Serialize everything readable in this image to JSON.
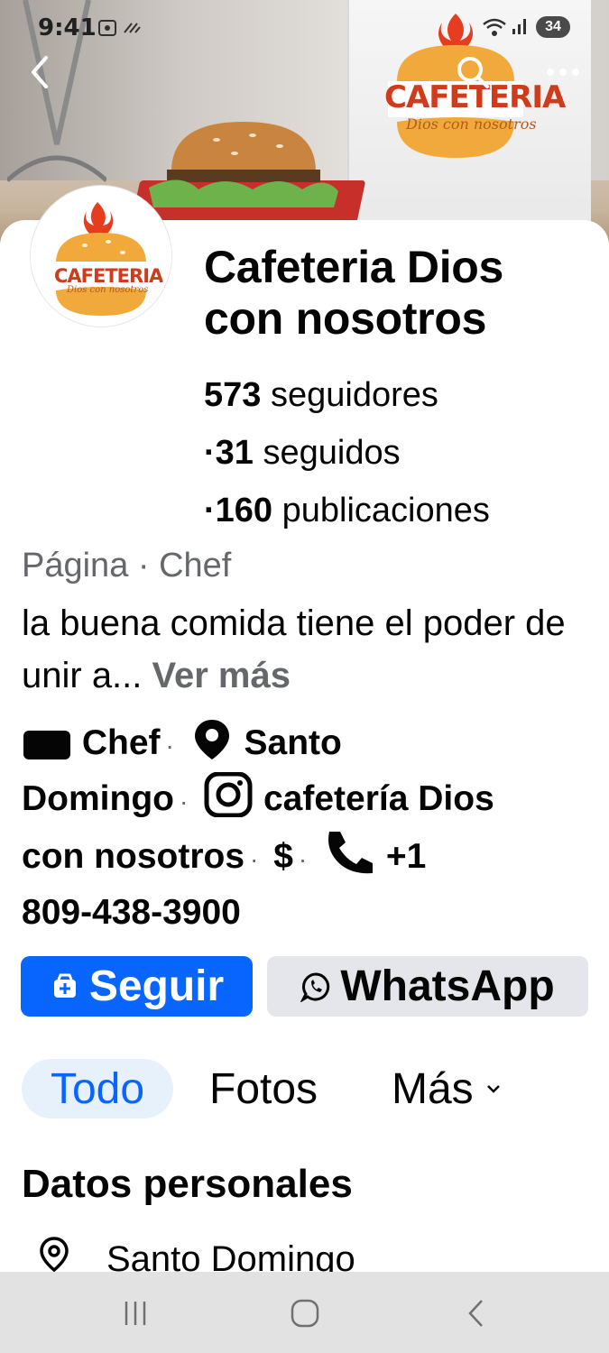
{
  "status_bar": {
    "time": "9:41",
    "battery": "34"
  },
  "cover": {
    "back_icon": "back-arrow-icon",
    "search_icon": "search-icon",
    "menu_icon": "more-options-icon"
  },
  "logo": {
    "text": "CAFETERIA",
    "tagline": "Dios con nosotros"
  },
  "profile": {
    "name": "Cafeteria Dios con nosotros",
    "followers_count": "573",
    "followers_label": "seguidores",
    "following_count": "31",
    "following_label": "seguidos",
    "posts_count": "160",
    "posts_label": "publicaciones",
    "category": "Página · Chef",
    "bio": "la buena comida tiene el poder de unir a...",
    "see_more": "Ver más"
  },
  "details": {
    "category": "Chef",
    "location_part1": "Santo",
    "location_part2": "Domingo",
    "instagram_part1": "cafetería Dios",
    "instagram_part2": "con nosotros",
    "price": "$",
    "phone_part1": "+1",
    "phone_part2": "809-438-3900",
    "separator": "·"
  },
  "actions": {
    "follow_label": "Seguir",
    "whatsapp_label": "WhatsApp"
  },
  "tabs": [
    {
      "label": "Todo",
      "active": true
    },
    {
      "label": "Fotos",
      "active": false
    },
    {
      "label": "Más",
      "active": false
    }
  ],
  "about": {
    "title": "Datos personales",
    "location": "Santo Domingo"
  },
  "colors": {
    "primary": "#0866ff",
    "secondary_bg": "#e4e6eb",
    "muted_text": "#65676b",
    "tab_active_bg": "#e7f1fc"
  }
}
